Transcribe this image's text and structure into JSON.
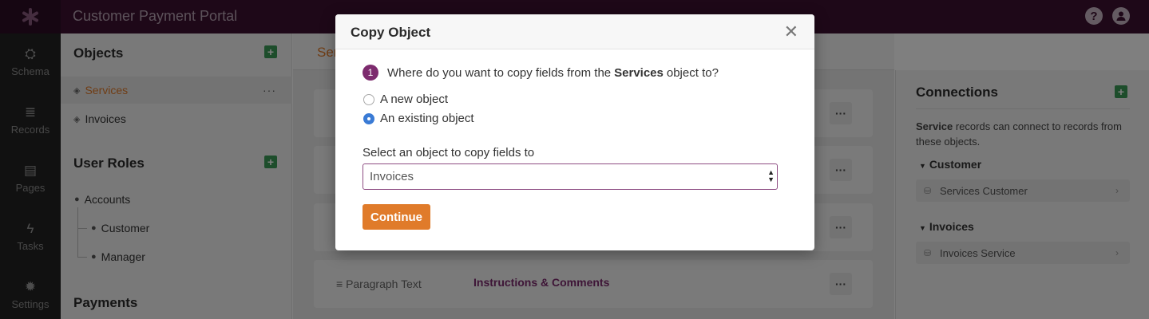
{
  "app": {
    "title": "Customer Payment Portal",
    "logo_icon": "asterisk-icon"
  },
  "topbar": {
    "help_icon": "?",
    "user_icon": "user-icon"
  },
  "rail": {
    "items": [
      {
        "label": "Schema",
        "glyph": "⛭"
      },
      {
        "label": "Records",
        "glyph": "≣"
      },
      {
        "label": "Pages",
        "glyph": "▤"
      },
      {
        "label": "Tasks",
        "glyph": "ϟ"
      },
      {
        "label": "Settings",
        "glyph": "✹"
      }
    ]
  },
  "objects_panel": {
    "heading": "Objects",
    "items": [
      {
        "label": "Services",
        "active": true
      },
      {
        "label": "Invoices",
        "active": false
      }
    ],
    "more": "···",
    "roles_heading": "User Roles",
    "roles": [
      {
        "label": "Accounts"
      },
      {
        "label": "Customer"
      },
      {
        "label": "Manager"
      }
    ],
    "payments_heading": "Payments"
  },
  "main": {
    "tab_label": "Ser",
    "rows": [
      {
        "type": "",
        "name": ""
      },
      {
        "type": "",
        "name": ""
      },
      {
        "type": "",
        "name": ""
      },
      {
        "type": "Paragraph Text",
        "name": "Instructions & Comments"
      }
    ],
    "more": "···"
  },
  "connections": {
    "title": "Connections",
    "desc_bold": "Service",
    "desc_rest": " records can connect to records from these objects.",
    "groups": [
      {
        "label": "Customer",
        "item": "Services Customer"
      },
      {
        "label": "Invoices",
        "item": "Invoices Service"
      }
    ]
  },
  "modal": {
    "title": "Copy Object",
    "close": "✕",
    "step_number": "1",
    "question_pre": "Where do you want to copy fields from the",
    "question_obj": "Services",
    "question_post": "object to?",
    "options": [
      {
        "label": "A new object",
        "checked": false
      },
      {
        "label": "An existing object",
        "checked": true
      }
    ],
    "select_label": "Select an object to copy fields to",
    "select_value": "Invoices",
    "continue_label": "Continue"
  },
  "colors": {
    "brand": "#3d1131",
    "accent": "#e07b2a",
    "badge": "#7d2b6e"
  }
}
